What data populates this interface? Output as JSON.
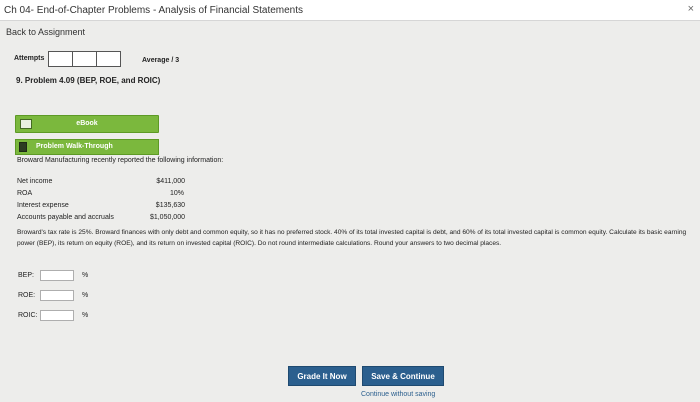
{
  "window": {
    "title": "Ch 04- End-of-Chapter Problems - Analysis of Financial Statements",
    "close_glyph": "×"
  },
  "nav": {
    "back_label": "Back to Assignment"
  },
  "attempts": {
    "label": "Attempts",
    "average_label": "Average / 3"
  },
  "problem": {
    "title": "9. Problem 4.09 (BEP, ROE, and ROIC)"
  },
  "tools": {
    "ebook_label": "eBook",
    "walkthrough_label": "Problem Walk-Through"
  },
  "intro": "Broward Manufacturing recently reported the following information:",
  "info": [
    {
      "label": "Net income",
      "value": "$411,000"
    },
    {
      "label": "ROA",
      "value": "10%"
    },
    {
      "label": "Interest expense",
      "value": "$135,630"
    },
    {
      "label": "Accounts payable and accruals",
      "value": "$1,050,000"
    }
  ],
  "paragraph": "Broward's tax rate is 25%. Broward finances with only debt and common equity, so it has no preferred stock. 40% of its total invested capital is debt, and 60% of its total invested capital is common equity. Calculate its basic earning power (BEP), its return on equity (ROE), and its return on invested capital (ROIC). Do not round intermediate calculations. Round your answers to two decimal places.",
  "answers": [
    {
      "label": "BEP:",
      "value": "",
      "unit": "%"
    },
    {
      "label": "ROE:",
      "value": "",
      "unit": "%"
    },
    {
      "label": "ROIC:",
      "value": "",
      "unit": "%"
    }
  ],
  "actions": {
    "grade_label": "Grade It Now",
    "save_label": "Save & Continue",
    "continue_label": "Continue without saving"
  },
  "colors": {
    "accent_green": "#7bb83d",
    "button_blue": "#2b5f8e"
  }
}
